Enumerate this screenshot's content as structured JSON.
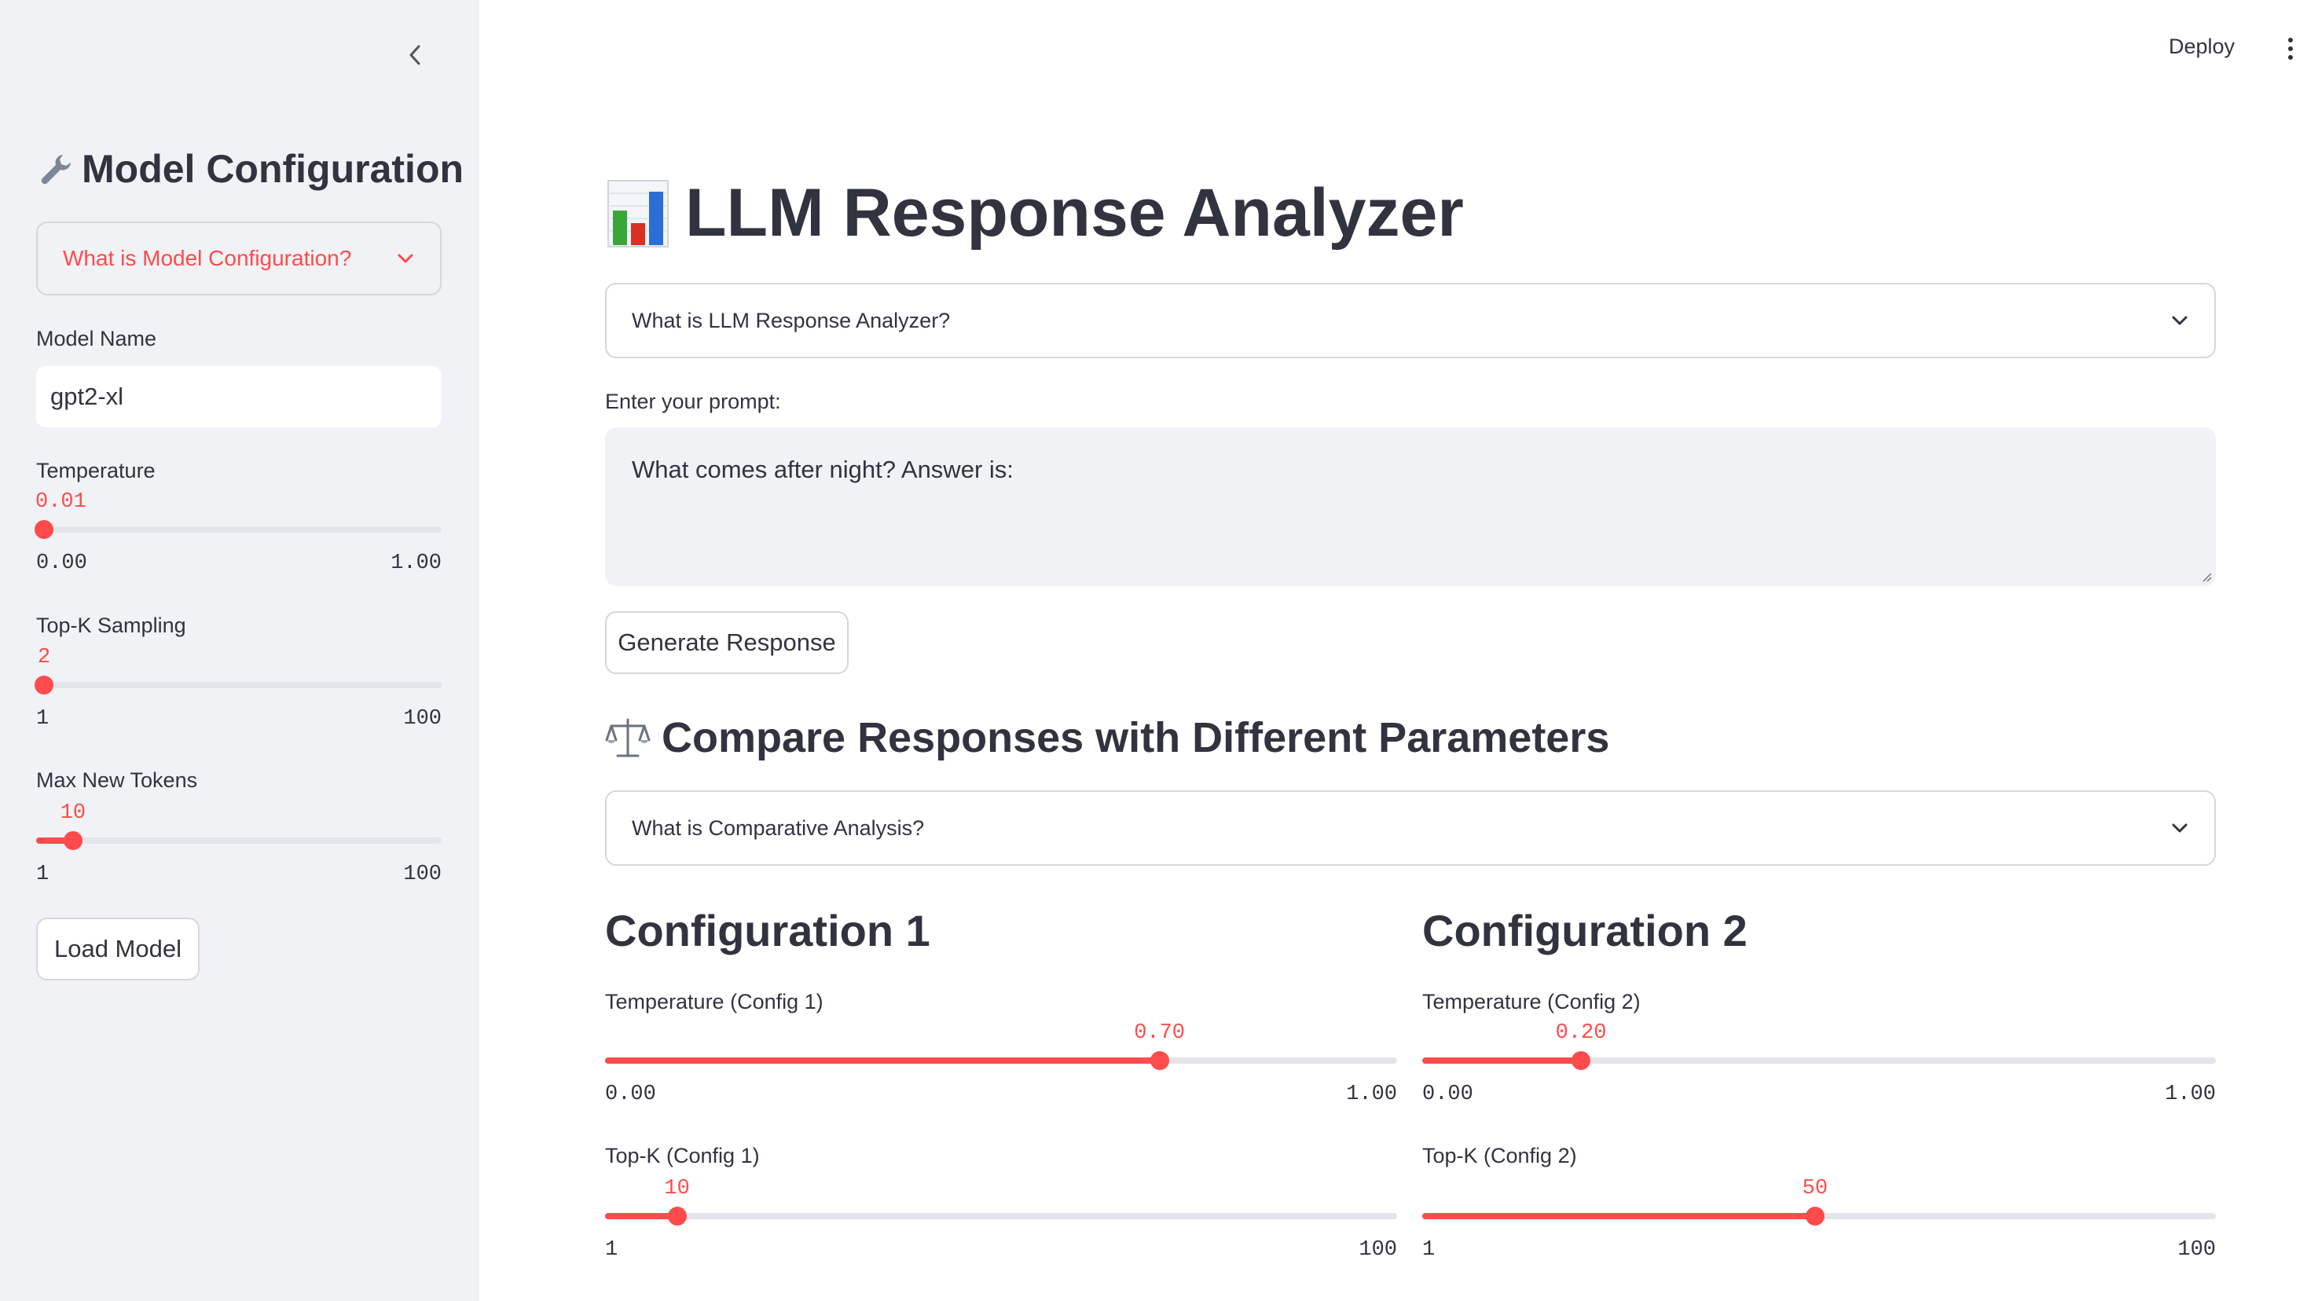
{
  "header": {
    "deploy_label": "Deploy",
    "menu_icon": "vertical-dots-icon"
  },
  "sidebar": {
    "collapse_icon": "chevron-left-icon",
    "title": "Model Configuration",
    "title_icon": "wrench-icon",
    "expander_label": "What is Model Configuration?",
    "model_name_label": "Model Name",
    "model_name_value": "gpt2-xl",
    "sliders": {
      "temperature": {
        "label": "Temperature",
        "value": "0.01",
        "min": "0.00",
        "max": "1.00",
        "fraction": 0.01
      },
      "topk": {
        "label": "Top-K Sampling",
        "value": "2",
        "min": "1",
        "max": "100",
        "fraction": 0.0101
      },
      "max_tokens": {
        "label": "Max New Tokens",
        "value": "10",
        "min": "1",
        "max": "100",
        "fraction": 0.0909
      }
    },
    "load_button": "Load Model"
  },
  "main": {
    "title": "LLM Response Analyzer",
    "title_icon": "bar-chart-icon",
    "analyzer_expander": "What is LLM Response Analyzer?",
    "prompt_label": "Enter your prompt:",
    "prompt_value": "What comes after night? Answer is:",
    "generate_button": "Generate Response",
    "compare_title": "Compare Responses with Different Parameters",
    "compare_icon": "balance-scale-icon",
    "compare_expander": "What is Comparative Analysis?",
    "config1": {
      "title": "Configuration 1",
      "temperature": {
        "label": "Temperature (Config 1)",
        "value": "0.70",
        "min": "0.00",
        "max": "1.00",
        "fraction": 0.7
      },
      "topk": {
        "label": "Top-K (Config 1)",
        "value": "10",
        "min": "1",
        "max": "100",
        "fraction": 0.0909
      }
    },
    "config2": {
      "title": "Configuration 2",
      "temperature": {
        "label": "Temperature (Config 2)",
        "value": "0.20",
        "min": "0.00",
        "max": "1.00",
        "fraction": 0.2
      },
      "topk": {
        "label": "Top-K (Config 2)",
        "value": "50",
        "min": "1",
        "max": "100",
        "fraction": 0.4949
      }
    }
  },
  "colors": {
    "accent": "#ff4b4b",
    "sidebar_bg": "#f0f2f6",
    "text": "#31333f",
    "border": "#d6d7dc"
  }
}
